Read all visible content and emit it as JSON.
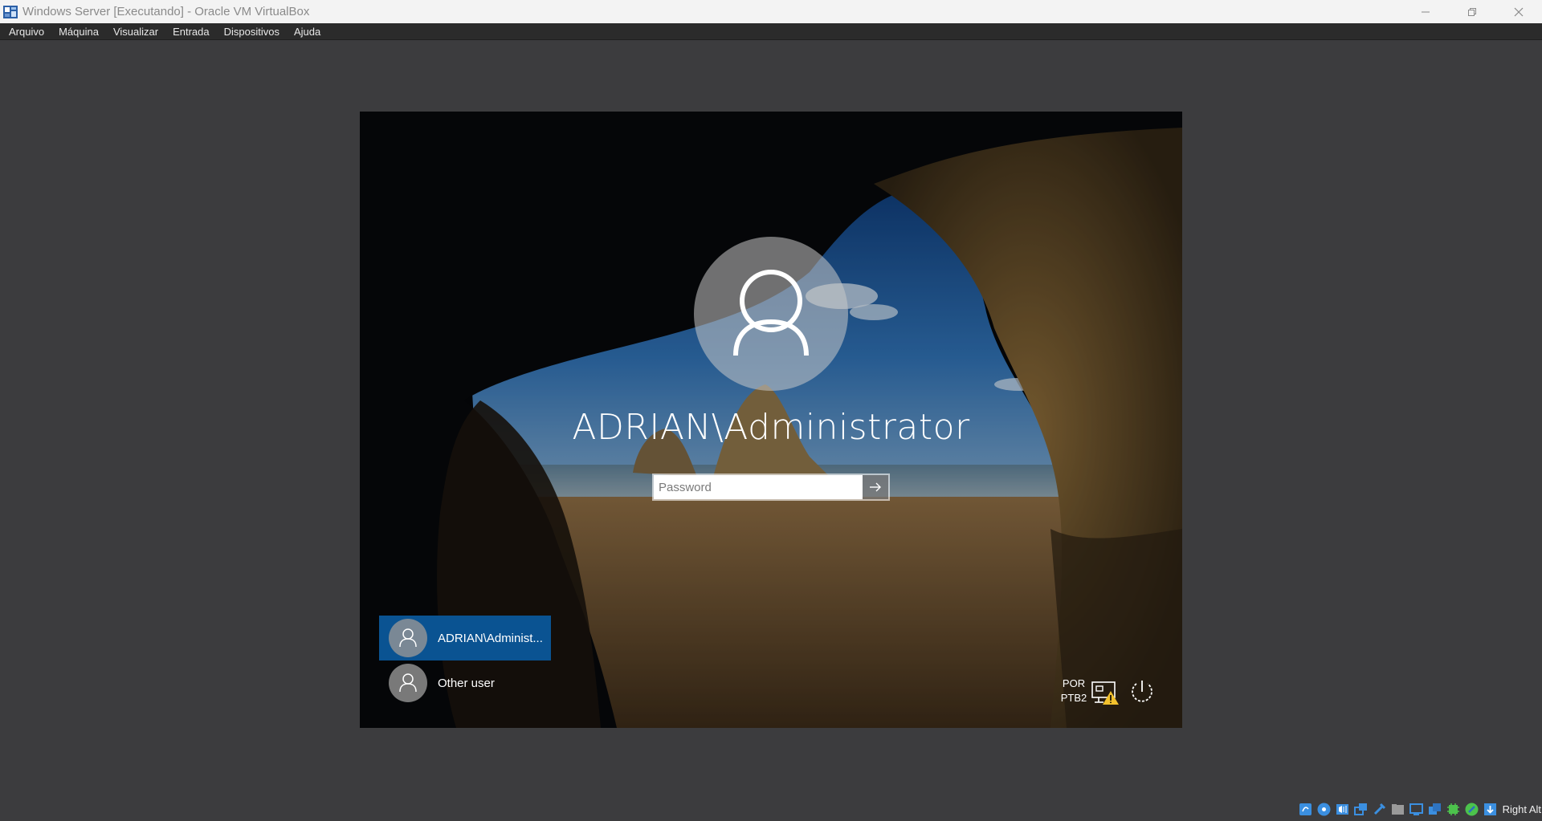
{
  "window": {
    "title": "Windows Server [Executando] - Oracle VM VirtualBox",
    "controls": [
      "minimize-icon",
      "restore-icon",
      "close-icon"
    ]
  },
  "menu": {
    "items": [
      {
        "label": "Arquivo"
      },
      {
        "label": "Máquina"
      },
      {
        "label": "Visualizar"
      },
      {
        "label": "Entrada"
      },
      {
        "label": "Dispositivos"
      },
      {
        "label": "Ajuda"
      }
    ]
  },
  "login": {
    "username": "ADRIAN\\Administrator",
    "password": {
      "placeholder": "Password",
      "value": ""
    },
    "submit_icon": "arrow-right-icon"
  },
  "users": [
    {
      "label": "ADRIAN\\Administ...",
      "selected": true
    },
    {
      "label": "Other user",
      "selected": false
    }
  ],
  "tray": {
    "lang_line1": "POR",
    "lang_line2": "PTB2",
    "network_icon": "network-warning-icon",
    "power_icon": "power-icon"
  },
  "statusbar": {
    "icons": [
      "hard-disk-icon",
      "optical-drive-icon",
      "audio-icon",
      "network-adapters-icon",
      "usb-icon",
      "shared-folders-icon",
      "display-icon",
      "video-capture-icon",
      "cpu-icon",
      "mouse-integration-icon",
      "keyboard-capture-icon"
    ],
    "host_key": "Right Alt"
  },
  "colors": {
    "titlebar_bg": "#f3f3f3",
    "menubar_bg": "#2b2b2b",
    "workspace_bg": "#3c3c3e",
    "selected_user_bg": "#0a5392"
  }
}
